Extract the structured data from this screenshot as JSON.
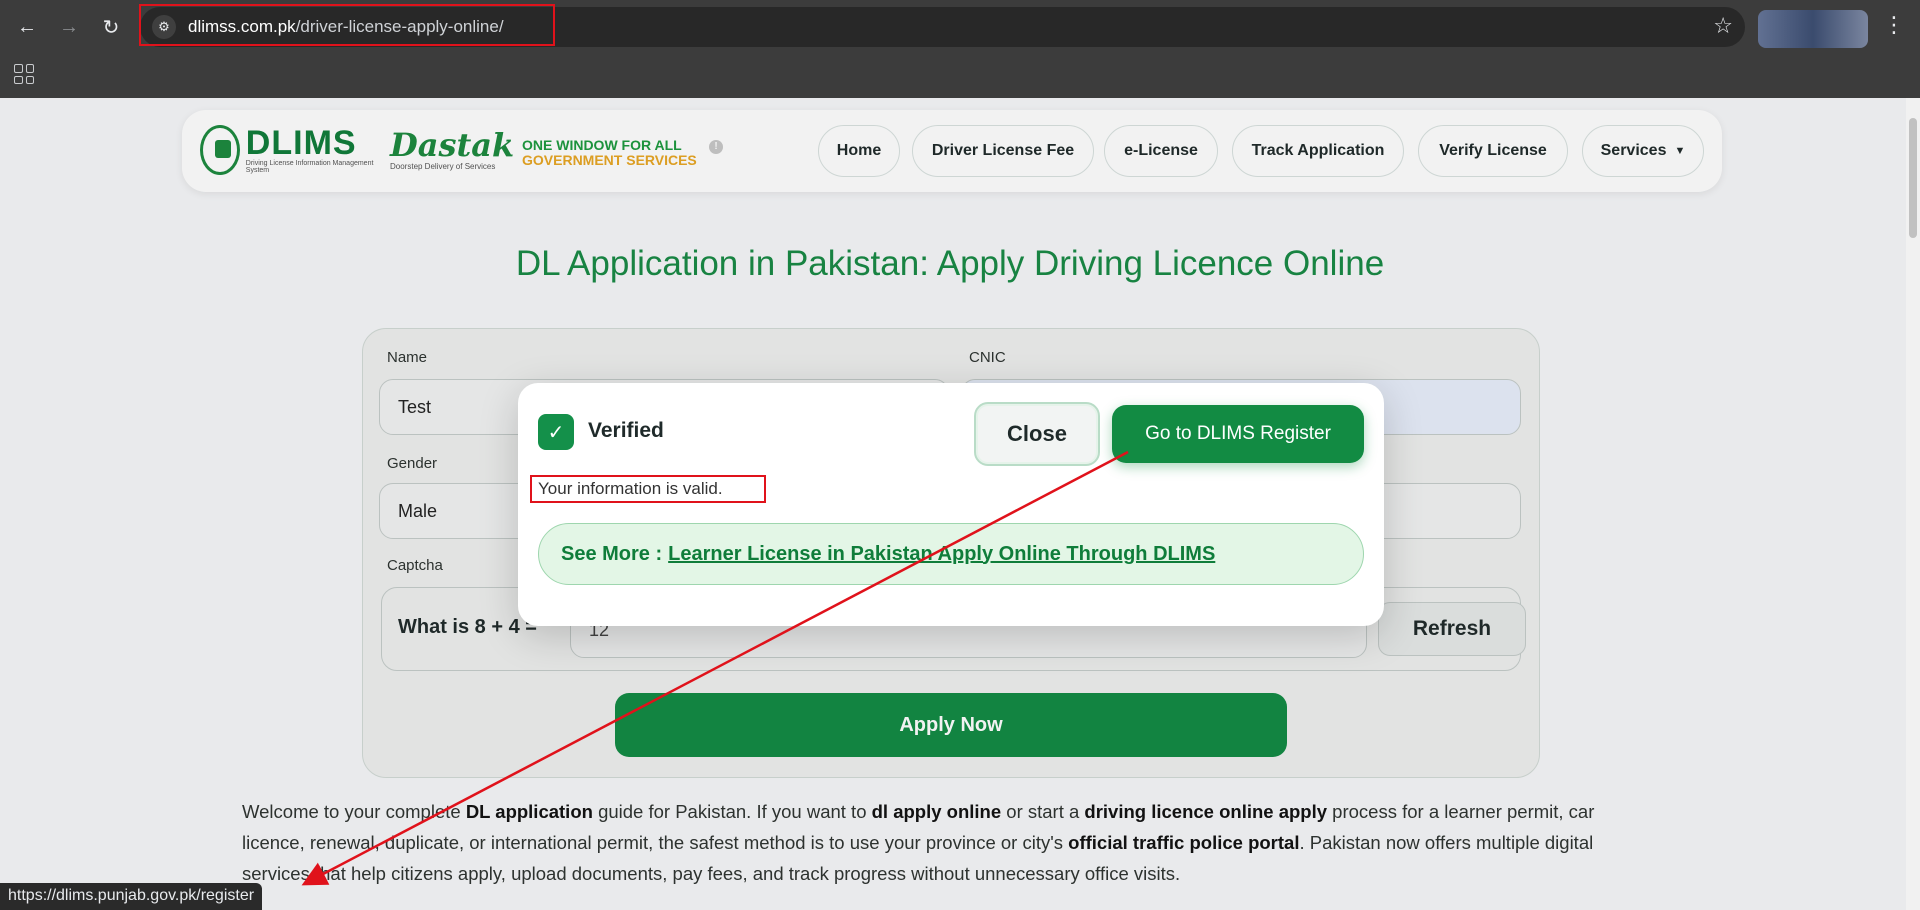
{
  "browser": {
    "url_host": "dlimss.com.pk",
    "url_path": "/driver-license-apply-online/",
    "status_url": "https://dlims.punjab.gov.pk/register"
  },
  "site": {
    "logo_dlims": "DLIMS",
    "logo_dlims_sub": "Driving License Information Management System",
    "logo_dastak": "Dastak",
    "logo_dastak_sub": "Doorstep Delivery of Services",
    "tagline_1": "ONE WINDOW FOR ALL",
    "tagline_2": "GOVERNMENT SERVICES",
    "nav": {
      "home": "Home",
      "fee": "Driver License Fee",
      "elicense": "e-License",
      "track": "Track Application",
      "verify": "Verify License",
      "services": "Services",
      "services_caret": "▼"
    }
  },
  "page": {
    "title": "DL Application in Pakistan: Apply Driving Licence Online"
  },
  "form": {
    "name_label": "Name",
    "name_value": "Test",
    "cnic_label": "CNIC",
    "gender_label": "Gender",
    "gender_value": "Male",
    "captcha_label": "Captcha",
    "captcha_question": "What is 8 + 4 =",
    "captcha_value": "12",
    "refresh": "Refresh",
    "apply": "Apply Now"
  },
  "intro": {
    "p1": "Welcome to your complete ",
    "b1": "DL application",
    "p2": " guide for Pakistan. If you want to ",
    "b2": "dl apply online",
    "p3": " or start a ",
    "b3": "driving licence online apply",
    "p4": " process for a learner permit, car licence, renewal, duplicate, or international permit, the safest method is to use your province or city's ",
    "b4": "official traffic police portal",
    "p5": ". Pakistan now offers multiple digital services that help citizens apply, upload documents, pay fees, and track progress without unnecessary office visits."
  },
  "modal": {
    "verified": "Verified",
    "close": "Close",
    "goto": "Go to DLIMS Register",
    "message": "Your information is valid.",
    "see_more": "See More :",
    "see_more_link": "Learner License in Pakistan Apply Online Through DLIMS"
  },
  "colors": {
    "brand_green": "#128b43",
    "annotation_red": "#e0121b"
  }
}
